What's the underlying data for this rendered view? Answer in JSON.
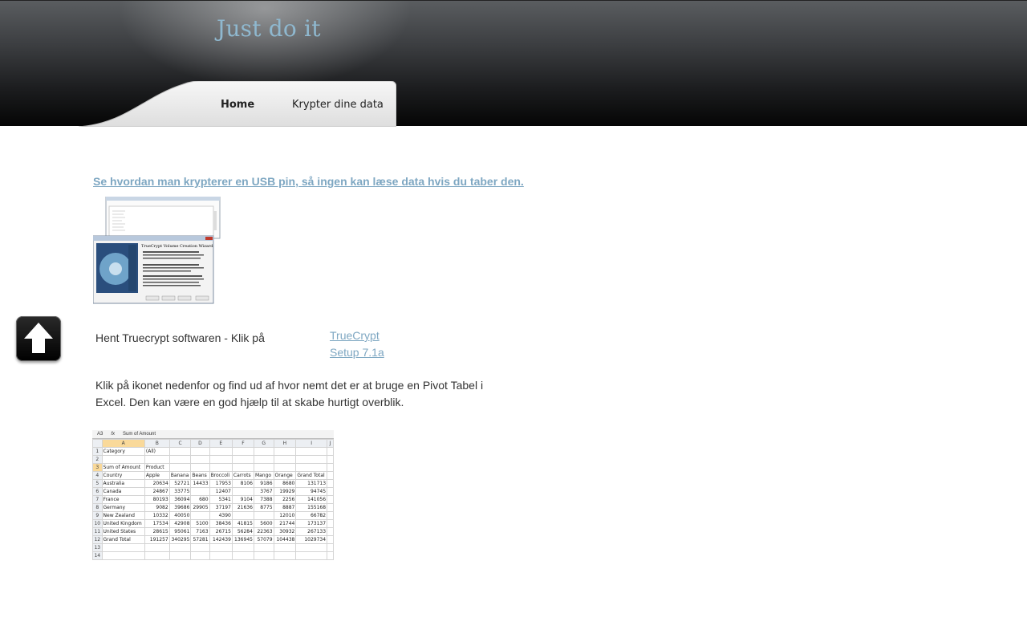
{
  "header": {
    "site_title": "Just do it"
  },
  "nav": {
    "items": [
      {
        "label": "Home"
      },
      {
        "label": "Krypter dine data"
      }
    ]
  },
  "main": {
    "headline": "Se hvordan man krypterer en USB pin, så ingen kan læse data hvis du taber den.",
    "download_text": "Hent Truecrypt softwaren - Klik på",
    "download_link": "TrueCrypt Setup 7.1a",
    "pivot_text": "Klik på ikonet nedenfor og find ud af hvor nemt det er at bruge en Pivot Tabel i Excel. Den kan være en god hjælp til at skabe hurtigt overblik."
  },
  "icons": {
    "scroll_top": "up-arrow-icon",
    "thumbnail": "truecrypt-screenshot"
  },
  "excel": {
    "cell_ref": "A3",
    "formula": "Sum of Amount",
    "columns": [
      "A",
      "B",
      "C",
      "D",
      "E",
      "F",
      "G",
      "H",
      "I",
      "J"
    ],
    "rows": [
      [
        "Category",
        "(All)",
        "",
        "",
        "",
        "",
        "",
        "",
        ""
      ],
      [
        "",
        "",
        "",
        "",
        "",
        "",
        "",
        "",
        ""
      ],
      [
        "Sum of Amount",
        "Product",
        "",
        "",
        "",
        "",
        "",
        "",
        ""
      ],
      [
        "Country",
        "Apple",
        "Banana",
        "Beans",
        "Broccoli",
        "Carrots",
        "Mango",
        "Orange",
        "Grand Total"
      ],
      [
        "Australia",
        "20634",
        "52721",
        "14433",
        "17953",
        "8106",
        "9186",
        "8680",
        "131713"
      ],
      [
        "Canada",
        "24867",
        "33775",
        "",
        "12407",
        "",
        "3767",
        "19929",
        "94745"
      ],
      [
        "France",
        "80193",
        "36094",
        "680",
        "5341",
        "9104",
        "7388",
        "2256",
        "141056"
      ],
      [
        "Germany",
        "9082",
        "39686",
        "29905",
        "37197",
        "21636",
        "8775",
        "8887",
        "155168"
      ],
      [
        "New Zealand",
        "10332",
        "40050",
        "",
        "4390",
        "",
        "",
        "12010",
        "66782"
      ],
      [
        "United Kingdom",
        "17534",
        "42908",
        "5100",
        "38436",
        "41815",
        "5600",
        "21744",
        "173137"
      ],
      [
        "United States",
        "28615",
        "95061",
        "7163",
        "26715",
        "56284",
        "22363",
        "30932",
        "267133"
      ],
      [
        "Grand Total",
        "191257",
        "340295",
        "57281",
        "142439",
        "136945",
        "57079",
        "104438",
        "1029734"
      ],
      [
        "",
        "",
        "",
        "",
        "",
        "",
        "",
        "",
        ""
      ],
      [
        "",
        "",
        "",
        "",
        "",
        "",
        "",
        "",
        ""
      ]
    ]
  }
}
